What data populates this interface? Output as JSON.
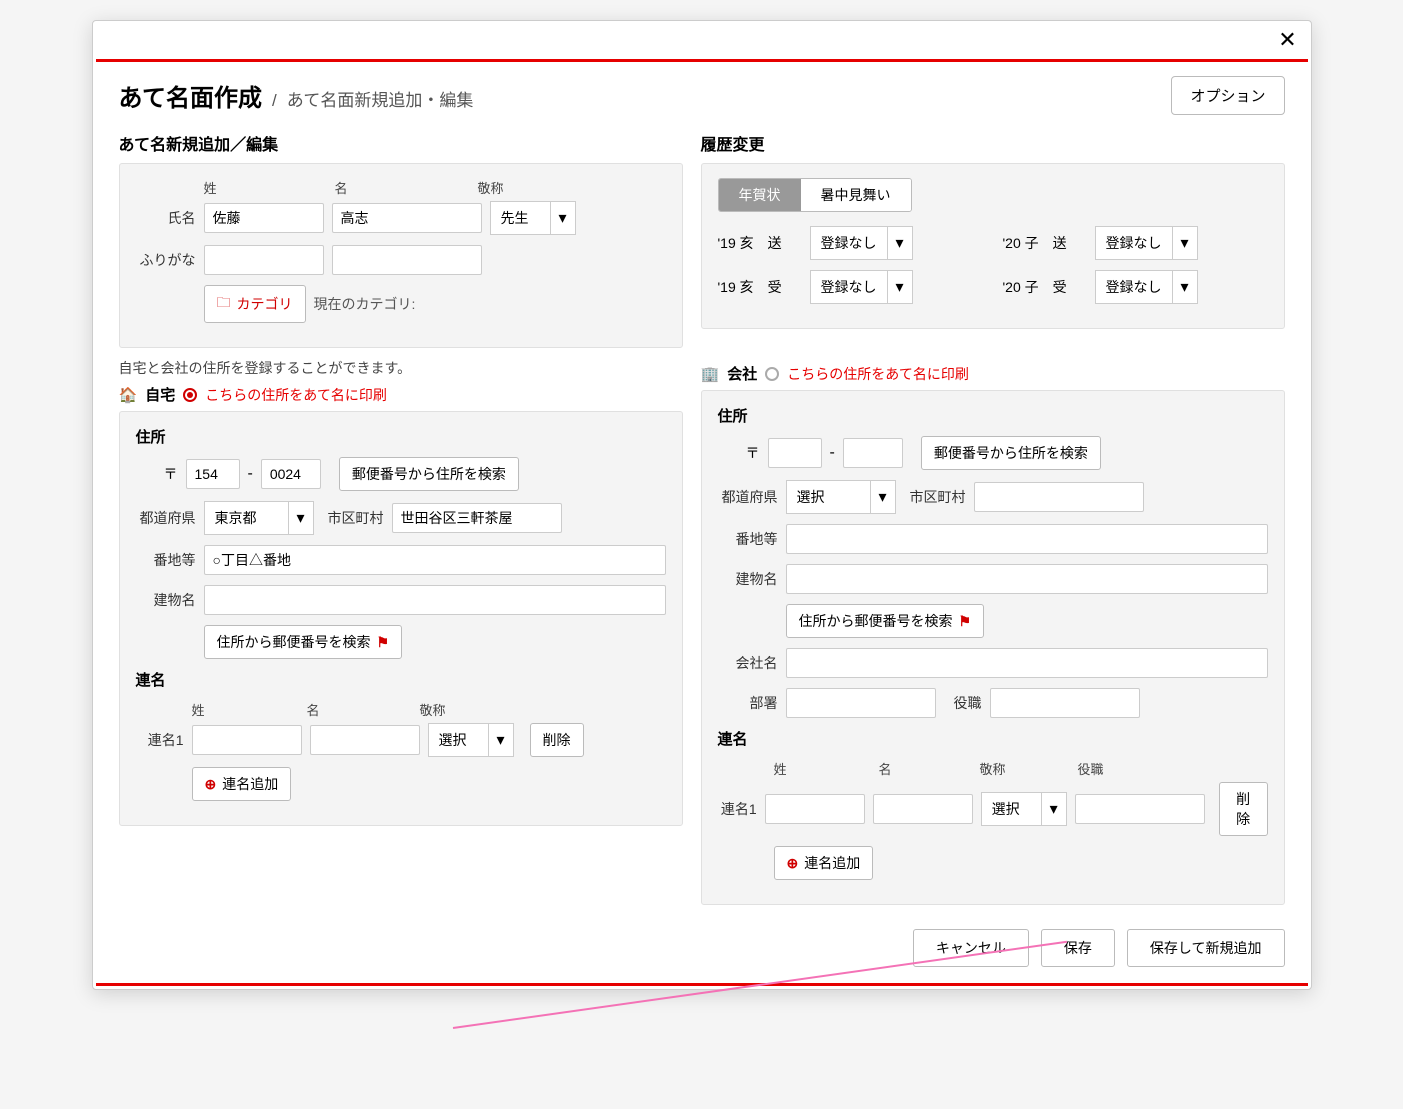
{
  "titlebar": {
    "close": "✕"
  },
  "header": {
    "title": "あて名面作成",
    "separator": "/",
    "subtitle": "あて名面新規追加・編集",
    "option": "オプション"
  },
  "left": {
    "section_title": "あて名新規追加／編集",
    "col_sei": "姓",
    "col_mei": "名",
    "col_keisho": "敬称",
    "label_shimei": "氏名",
    "val_sei": "佐藤",
    "val_mei": "高志",
    "val_keisho": "先生",
    "label_furigana": "ふりがな",
    "category_btn": "カテゴリ",
    "category_current": "現在のカテゴリ:",
    "note": "自宅と会社の住所を登録することができます。",
    "home_label": "自宅",
    "print_note": "こちらの住所をあて名に印刷",
    "addr_header": "住所",
    "postal_mark": "〒",
    "postal1": "154",
    "postal_dash": "-",
    "postal2": "0024",
    "search_from_postal": "郵便番号から住所を検索",
    "pref_label": "都道府県",
    "pref_val": "東京都",
    "city_label": "市区町村",
    "city_val": "世田谷区三軒茶屋",
    "banchi_label": "番地等",
    "banchi_val": "○丁目△番地",
    "building_label": "建物名",
    "search_from_addr": "住所から郵便番号を検索",
    "renmei_header": "連名",
    "renmei_sei": "姓",
    "renmei_mei": "名",
    "renmei_keisho": "敬称",
    "renmei1_label": "連名1",
    "renmei_keisho_val": "選択",
    "delete_btn": "削除",
    "add_renmei": "連名追加"
  },
  "right": {
    "history_title": "履歴変更",
    "tab1": "年賀状",
    "tab2": "暑中見舞い",
    "h1_label": "'19 亥　送",
    "h1_val": "登録なし",
    "h2_label": "'20 子　送",
    "h2_val": "登録なし",
    "h3_label": "'19 亥　受",
    "h3_val": "登録なし",
    "h4_label": "'20 子　受",
    "h4_val": "登録なし",
    "company_label": "会社",
    "print_note": "こちらの住所をあて名に印刷",
    "addr_header": "住所",
    "postal_mark": "〒",
    "postal_dash": "-",
    "search_from_postal": "郵便番号から住所を検索",
    "pref_label": "都道府県",
    "pref_val": "選択",
    "city_label": "市区町村",
    "banchi_label": "番地等",
    "building_label": "建物名",
    "search_from_addr": "住所から郵便番号を検索",
    "company_name_label": "会社名",
    "dept_label": "部署",
    "role_label": "役職",
    "renmei_header": "連名",
    "renmei_sei": "姓",
    "renmei_mei": "名",
    "renmei_keisho": "敬称",
    "renmei_role": "役職",
    "renmei1_label": "連名1",
    "renmei_keisho_val": "選択",
    "delete_btn": "削除",
    "add_renmei": "連名追加"
  },
  "footer": {
    "cancel": "キャンセル",
    "save": "保存",
    "save_new": "保存して新規追加"
  }
}
